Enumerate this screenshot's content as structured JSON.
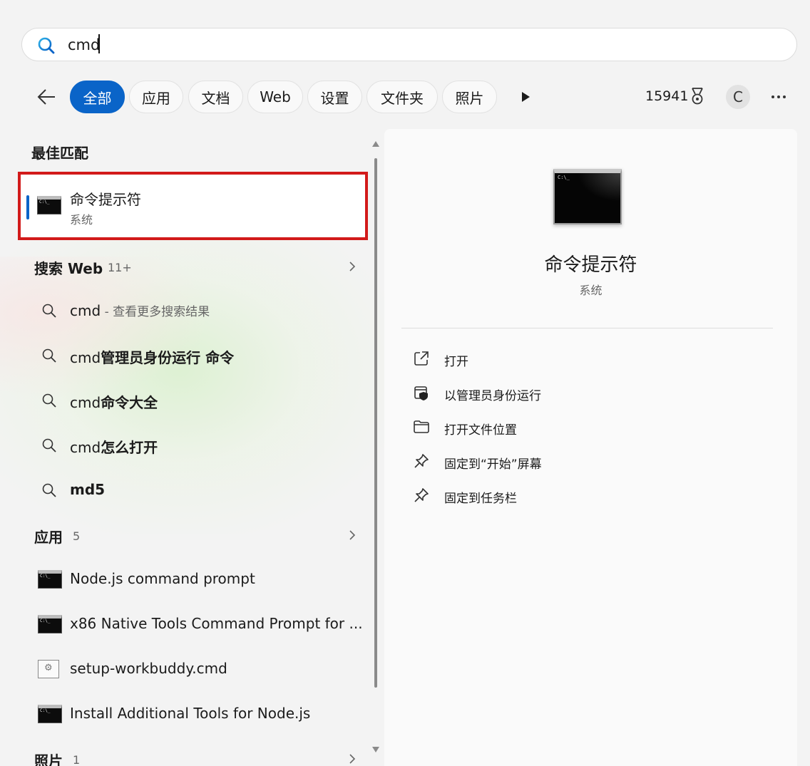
{
  "search": {
    "query": "cmd"
  },
  "filters": {
    "items": [
      "全部",
      "应用",
      "文档",
      "Web",
      "设置",
      "文件夹",
      "照片"
    ],
    "active_index": 0
  },
  "header": {
    "points": "15941",
    "avatar_letter": "C"
  },
  "results": {
    "best_match": {
      "title": "最佳匹配",
      "item": {
        "name": "命令提示符",
        "subtitle": "系统"
      }
    },
    "web": {
      "title": "搜索 Web",
      "count": "11+",
      "items": [
        {
          "prefix": "cmd",
          "bold": "",
          "suffix": " - 查看更多搜索结果"
        },
        {
          "prefix": "cmd",
          "bold": "管理员身份运行 命令",
          "suffix": ""
        },
        {
          "prefix": "cmd",
          "bold": "命令大全",
          "suffix": ""
        },
        {
          "prefix": "cmd",
          "bold": "怎么打开",
          "suffix": ""
        },
        {
          "prefix": "",
          "bold": "md5",
          "suffix": ""
        }
      ]
    },
    "apps": {
      "title": "应用",
      "count": "5",
      "items": [
        {
          "name": "Node.js command prompt",
          "icon": "console-icon"
        },
        {
          "name": "x86 Native Tools Command Prompt for ...",
          "icon": "console-icon"
        },
        {
          "name": "setup-workbuddy.cmd",
          "icon": "script-file-icon"
        },
        {
          "name": "Install Additional Tools for Node.js",
          "icon": "console-icon"
        }
      ]
    },
    "photos": {
      "title": "照片",
      "count": "1"
    }
  },
  "detail": {
    "title": "命令提示符",
    "subtitle": "系统",
    "actions": [
      {
        "label": "打开",
        "icon": "open-external-icon"
      },
      {
        "label": "以管理员身份运行",
        "icon": "run-as-admin-icon"
      },
      {
        "label": "打开文件位置",
        "icon": "folder-icon"
      },
      {
        "label": "固定到“开始”屏幕",
        "icon": "pin-icon"
      },
      {
        "label": "固定到任务栏",
        "icon": "pin-icon"
      }
    ]
  },
  "colors": {
    "accent": "#0a64c8",
    "highlight_border": "#d21a1a",
    "background": "#f3f3f3"
  }
}
